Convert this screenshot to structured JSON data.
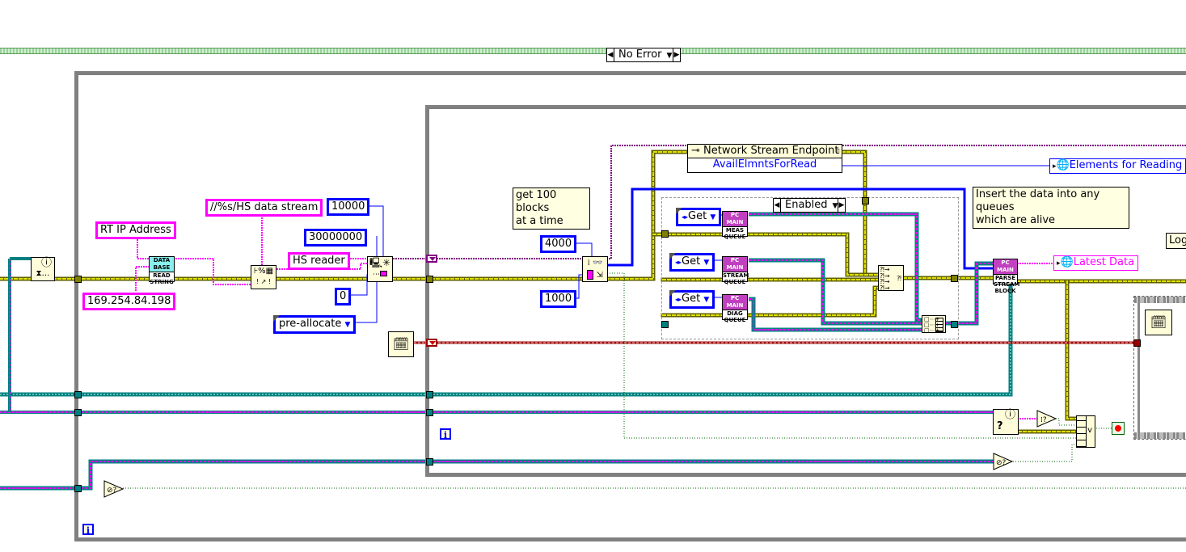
{
  "error_case_selector": {
    "value": "No Error"
  },
  "enabled_selector": {
    "value": "Enabled"
  },
  "constants": {
    "rt_ip_label": "RT IP Address",
    "rt_ip_default": "169.254.84.198",
    "stream_url_format": "//%s/HS data stream",
    "reader_name": "HS reader",
    "const_10000": "10000",
    "const_30000000": "30000000",
    "const_0": "0",
    "preallocate": "pre-allocate",
    "const_4000": "4000",
    "const_1000": "1000"
  },
  "comments": {
    "get_blocks": [
      "get 100 blocks",
      "at a time"
    ],
    "insert_data": [
      "Insert the data into any queues",
      "which are alive"
    ]
  },
  "property_node": {
    "class": "Network Stream Endpoint",
    "property": "AvailElmntsForRead"
  },
  "indicators": {
    "elements_for_reading": "Elements for Reading",
    "latest_data": "Latest Data",
    "log_partial": "Log"
  },
  "queue_ops": [
    {
      "op": "Get",
      "vi_header": "PC MAIN",
      "vi_label": [
        "MEAS",
        "QUEUE"
      ]
    },
    {
      "op": "Get",
      "vi_header": "PC MAIN",
      "vi_label": [
        "STREAM",
        "QUEUE"
      ]
    },
    {
      "op": "Get",
      "vi_header": "PC MAIN",
      "vi_label": [
        "DIAG",
        "QUEUE"
      ]
    }
  ],
  "subvis": {
    "db_read": {
      "header": "DATA BASE",
      "label": [
        "READ",
        "STRING"
      ]
    },
    "parse": {
      "header": "PC MAIN",
      "label": [
        "PARSE",
        "STREAM",
        "BLOCK"
      ]
    }
  },
  "iteration_label": "i",
  "colors": {
    "loop_border": "#808080",
    "string_wire": "#ff00ff",
    "error_wire": "#808000",
    "numeric_wire": "#0000ff",
    "refnum_wire": "#008080",
    "endpoint_wire": "#800080",
    "timestamp_wire": "#990000",
    "boolean_wire": "#006600"
  }
}
